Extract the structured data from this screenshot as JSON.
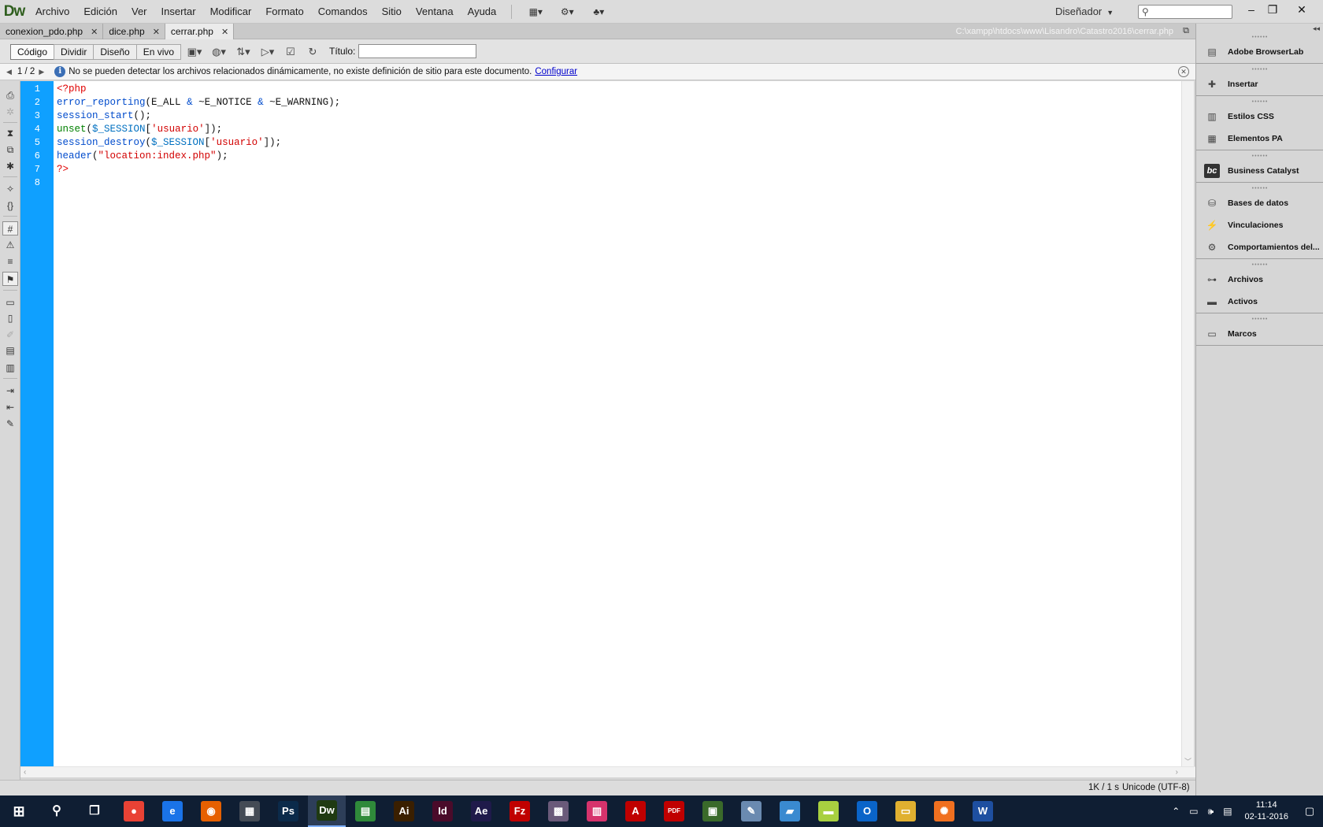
{
  "menubar": {
    "logo": "Dw",
    "items": [
      "Archivo",
      "Edición",
      "Ver",
      "Insertar",
      "Modificar",
      "Formato",
      "Comandos",
      "Sitio",
      "Ventana",
      "Ayuda"
    ],
    "workspace": "Diseñador",
    "search_placeholder": ""
  },
  "tabs": [
    {
      "label": "conexion_pdo.php",
      "active": false
    },
    {
      "label": "dice.php",
      "active": false
    },
    {
      "label": "cerrar.php",
      "active": true
    }
  ],
  "file_path": "C:\\xampp\\htdocs\\www\\Lisandro\\Catastro2016\\cerrar.php",
  "doc_toolbar": {
    "views": [
      "Código",
      "Dividir",
      "Diseño",
      "En vivo"
    ],
    "active_view": "Código",
    "title_label": "Título:",
    "title_value": ""
  },
  "infobar": {
    "pages": "1 / 2",
    "message": "No se pueden detectar los archivos relacionados dinámicamente, no existe definición de sitio para este documento.",
    "link": "Configurar"
  },
  "editor": {
    "line_numbers": [
      "1",
      "2",
      "3",
      "4",
      "5",
      "6",
      "7",
      "8"
    ],
    "gutter_color": "#0fa0ff",
    "lines": [
      {
        "tokens": [
          {
            "t": "<?php",
            "c": "tag"
          }
        ]
      },
      {
        "tokens": [
          {
            "t": "error_reporting",
            "c": "fn"
          },
          {
            "t": "(",
            "c": "const"
          },
          {
            "t": "E_ALL",
            "c": "const"
          },
          {
            "t": " & ",
            "c": "op"
          },
          {
            "t": "~E_NOTICE",
            "c": "const"
          },
          {
            "t": " & ",
            "c": "op"
          },
          {
            "t": "~E_WARNING",
            "c": "const"
          },
          {
            "t": ");",
            "c": "const"
          }
        ]
      },
      {
        "tokens": [
          {
            "t": "session_start",
            "c": "fn"
          },
          {
            "t": "();",
            "c": "const"
          }
        ]
      },
      {
        "tokens": [
          {
            "t": "unset",
            "c": "unset"
          },
          {
            "t": "(",
            "c": "const"
          },
          {
            "t": "$_SESSION",
            "c": "var"
          },
          {
            "t": "[",
            "c": "const"
          },
          {
            "t": "'usuario'",
            "c": "str"
          },
          {
            "t": "]);",
            "c": "const"
          }
        ]
      },
      {
        "tokens": [
          {
            "t": "session_destroy",
            "c": "fn"
          },
          {
            "t": "(",
            "c": "const"
          },
          {
            "t": "$_SESSION",
            "c": "var"
          },
          {
            "t": "[",
            "c": "const"
          },
          {
            "t": "'usuario'",
            "c": "str"
          },
          {
            "t": "]);",
            "c": "const"
          }
        ]
      },
      {
        "tokens": [
          {
            "t": "header",
            "c": "fn"
          },
          {
            "t": "(",
            "c": "const"
          },
          {
            "t": "\"location:index.php\"",
            "c": "str"
          },
          {
            "t": ");",
            "c": "const"
          }
        ]
      },
      {
        "tokens": [
          {
            "t": "?>",
            "c": "tag"
          }
        ]
      },
      {
        "tokens": []
      }
    ]
  },
  "statusbar": {
    "size": "1K / 1 s",
    "encoding": "Unicode (UTF-8)"
  },
  "panels": [
    {
      "items": [
        {
          "label": "Adobe BrowserLab",
          "icon": "browserlab-icon"
        }
      ]
    },
    {
      "items": [
        {
          "label": "Insertar",
          "icon": "insert-icon"
        }
      ]
    },
    {
      "items": [
        {
          "label": "Estilos CSS",
          "icon": "css-styles-icon"
        },
        {
          "label": "Elementos PA",
          "icon": "ap-elements-icon"
        }
      ]
    },
    {
      "items": [
        {
          "label": "Business Catalyst",
          "icon": "business-catalyst-icon"
        }
      ]
    },
    {
      "items": [
        {
          "label": "Bases de datos",
          "icon": "databases-icon"
        },
        {
          "label": "Vinculaciones",
          "icon": "bindings-icon"
        },
        {
          "label": "Comportamientos del...",
          "icon": "server-behaviors-icon"
        }
      ]
    },
    {
      "items": [
        {
          "label": "Archivos",
          "icon": "files-icon"
        },
        {
          "label": "Activos",
          "icon": "assets-icon"
        }
      ]
    },
    {
      "items": [
        {
          "label": "Marcos",
          "icon": "frames-icon"
        }
      ]
    }
  ],
  "taskbar": {
    "apps": [
      {
        "name": "chrome",
        "glyph": "●",
        "color": "#e94235"
      },
      {
        "name": "edge",
        "glyph": "e",
        "color": "#1a73e8"
      },
      {
        "name": "firefox",
        "glyph": "◉",
        "color": "#e66000"
      },
      {
        "name": "calculator",
        "glyph": "▦",
        "color": "#444b55"
      },
      {
        "name": "photoshop",
        "glyph": "Ps",
        "color": "#0b2a4a"
      },
      {
        "name": "dreamweaver",
        "glyph": "Dw",
        "color": "#1f3a12"
      },
      {
        "name": "green-app",
        "glyph": "▤",
        "color": "#2f8a3a"
      },
      {
        "name": "illustrator",
        "glyph": "Ai",
        "color": "#3a1f00"
      },
      {
        "name": "indesign",
        "glyph": "Id",
        "color": "#4a0b2a"
      },
      {
        "name": "after-effects",
        "glyph": "Ae",
        "color": "#1f1a4a"
      },
      {
        "name": "filezilla",
        "glyph": "Fz",
        "color": "#c00000"
      },
      {
        "name": "pixel-app",
        "glyph": "▩",
        "color": "#6a5a7a"
      },
      {
        "name": "pdf-editor",
        "glyph": "▥",
        "color": "#d6336c"
      },
      {
        "name": "acrobat",
        "glyph": "A",
        "color": "#c00000"
      },
      {
        "name": "pdf-app",
        "glyph": "PDF",
        "color": "#c00000"
      },
      {
        "name": "gallery-app",
        "glyph": "▣",
        "color": "#3a6a2a"
      },
      {
        "name": "paint-app",
        "glyph": "✎",
        "color": "#6a8ab0"
      },
      {
        "name": "notes-app",
        "glyph": "▰",
        "color": "#3a8ad0"
      },
      {
        "name": "folder-app",
        "glyph": "▬",
        "color": "#a8d040"
      },
      {
        "name": "outlook",
        "glyph": "O",
        "color": "#0a64c8"
      },
      {
        "name": "file-explorer",
        "glyph": "▭",
        "color": "#e0b030"
      },
      {
        "name": "xampp",
        "glyph": "✺",
        "color": "#f07020"
      },
      {
        "name": "word",
        "glyph": "W",
        "color": "#1e4fa0"
      }
    ],
    "time": "11:14",
    "date": "02-11-2016"
  }
}
